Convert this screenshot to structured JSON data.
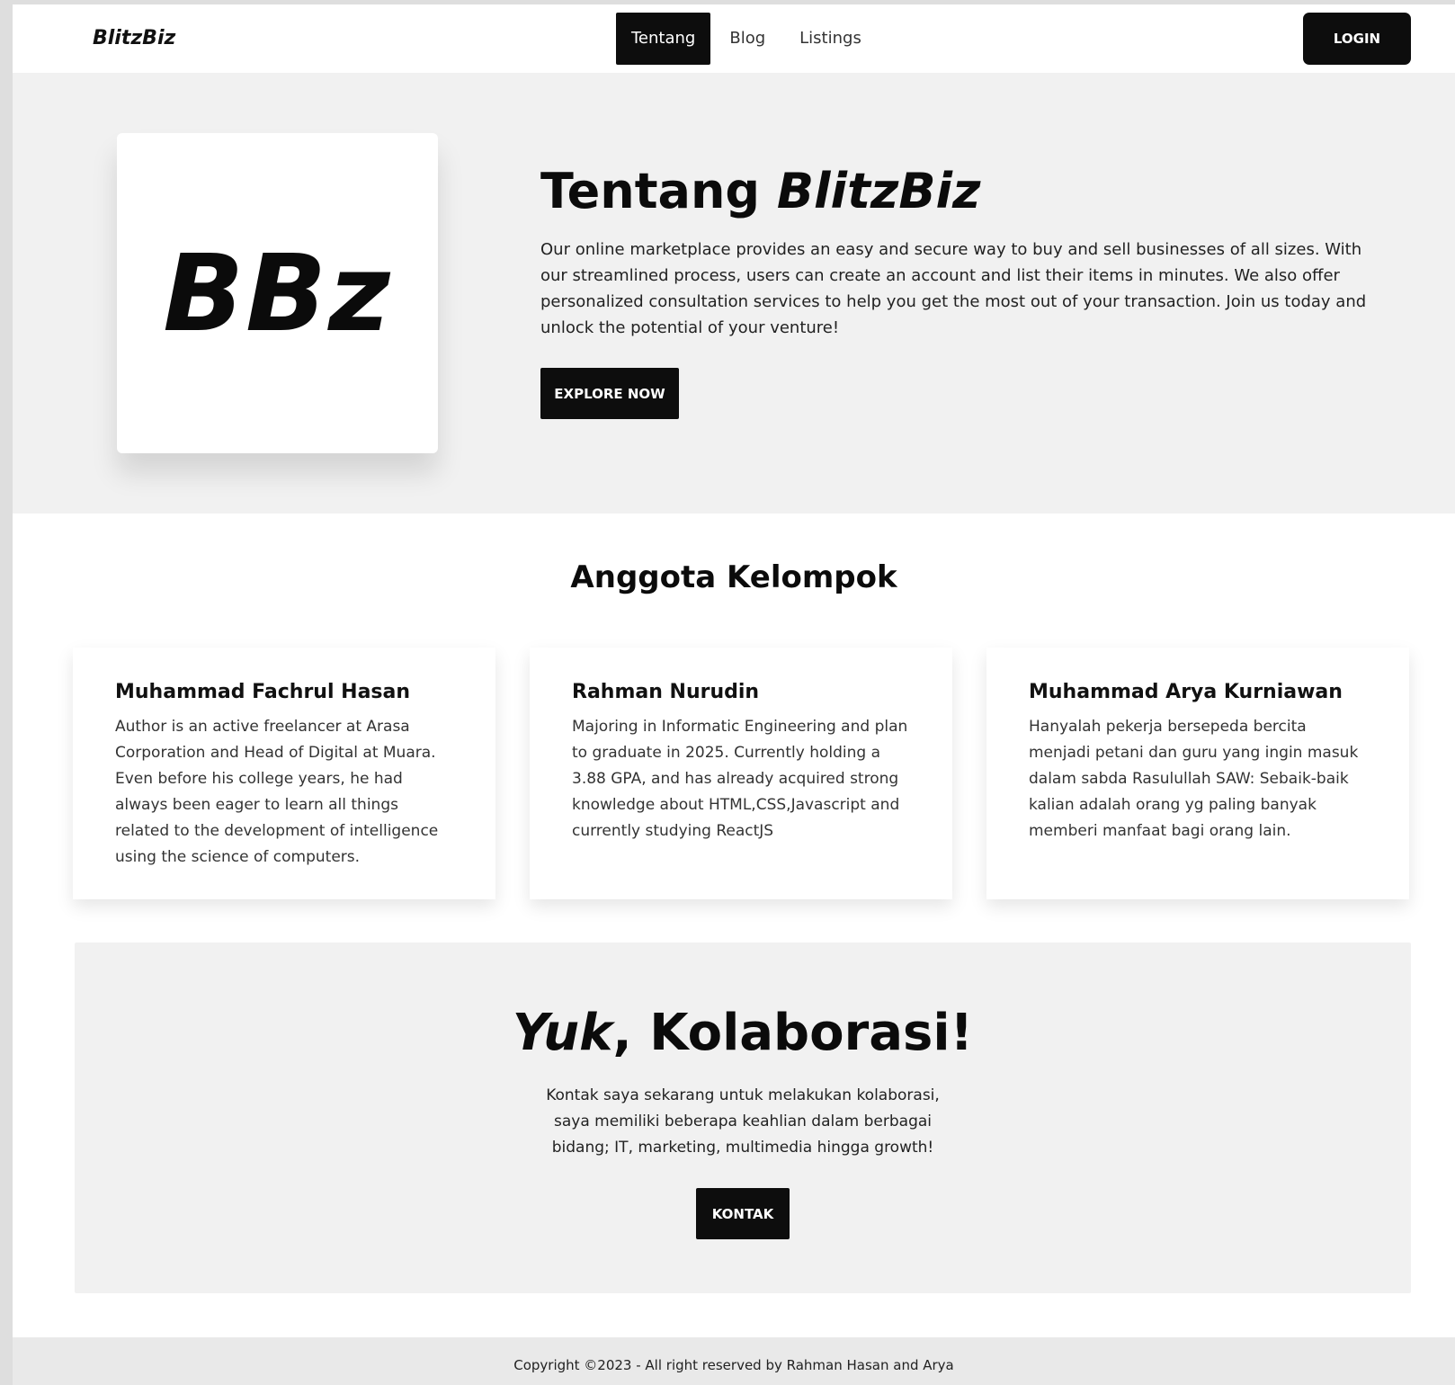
{
  "nav": {
    "brand": "BlitzBiz",
    "links": [
      {
        "label": "Tentang",
        "active": true
      },
      {
        "label": "Blog",
        "active": false
      },
      {
        "label": "Listings",
        "active": false
      }
    ],
    "login_label": "LOGIN"
  },
  "hero": {
    "logo_text": "BBz",
    "title_prefix": "Tentang ",
    "title_emphasis": "BlitzBiz",
    "description": "Our online marketplace provides an easy and secure way to buy and sell businesses of all sizes. With our streamlined process, users can create an account and list their items in minutes. We also offer personalized consultation services to help you get the most out of your transaction. Join us today and unlock the potential of your venture!",
    "cta_label": "EXPLORE NOW"
  },
  "members": {
    "title": "Anggota Kelompok",
    "cards": [
      {
        "name": "Muhammad Fachrul Hasan",
        "description": "Author is an active freelancer at Arasa Corporation and Head of Digital at Muara. Even before his college years, he had always been eager to learn all things related to the development of intelligence using the science of computers."
      },
      {
        "name": "Rahman Nurudin",
        "description": "Majoring in Informatic Engineering and plan to graduate in 2025. Currently holding a 3.88 GPA, and has already acquired strong knowledge about HTML,CSS,Javascript and currently studying ReactJS"
      },
      {
        "name": "Muhammad Arya Kurniawan",
        "description": "Hanyalah pekerja bersepeda bercita menjadi petani dan guru yang ingin masuk dalam sabda Rasulullah SAW: Sebaik-baik kalian adalah orang yg paling banyak memberi manfaat bagi orang lain."
      }
    ]
  },
  "collab": {
    "title_emphasis": "Yuk",
    "title_suffix": ", Kolaborasi!",
    "description": "Kontak saya sekarang untuk melakukan kolaborasi, saya memiliki beberapa keahlian dalam berbagai bidang; IT, marketing, multimedia hingga growth!",
    "button_label": "KONTAK"
  },
  "footer": {
    "copyright": "Copyright ©2023 - All right reserved by Rahman Hasan and Arya"
  }
}
